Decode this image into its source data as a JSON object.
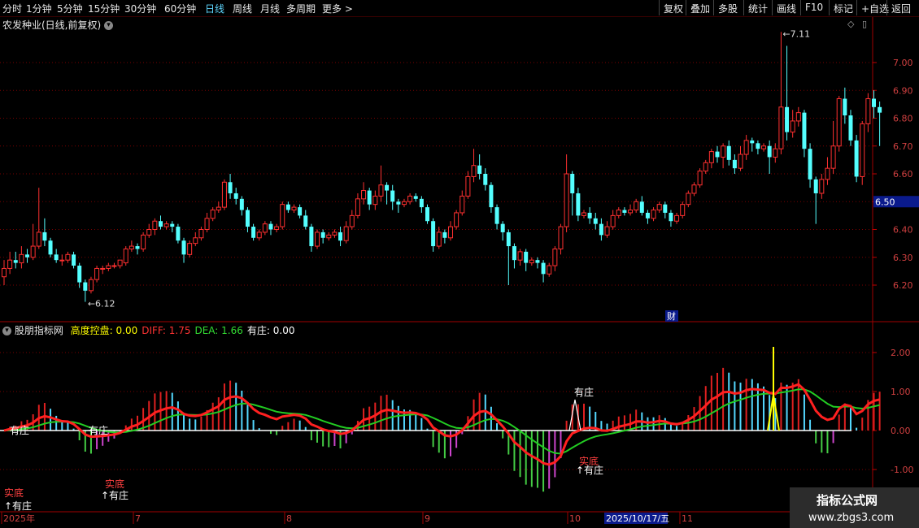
{
  "toolbar": {
    "periods": [
      "分时",
      "1分钟",
      "5分钟",
      "15分钟",
      "30分钟",
      "60分钟",
      "日线",
      "周线",
      "月线",
      "多周期",
      "更多 >"
    ],
    "active_period": "日线",
    "actions": [
      "复权",
      "叠加",
      "多股",
      "统计",
      "画线",
      "F10",
      "标记",
      "+自选",
      "返回"
    ]
  },
  "main_chart": {
    "title": "农发种业(日线,前复权)",
    "price_ticks": [
      "7.00",
      "6.90",
      "6.80",
      "6.70",
      "6.60",
      "6.50",
      "6.40",
      "6.30",
      "6.20"
    ],
    "current_price": "6.50",
    "high_label": "7.11",
    "low_label": "6.12",
    "marker": "财"
  },
  "indicator": {
    "name": "股朋指标网",
    "fields": [
      {
        "label": "高度控盘:",
        "value": "0.00",
        "color": "#ffff00"
      },
      {
        "label": "DIFF:",
        "value": "1.75",
        "color": "#ff3333"
      },
      {
        "label": "DEA:",
        "value": "1.66",
        "color": "#33dd33"
      },
      {
        "label": "有庄:",
        "value": "0.00",
        "color": "#ffffff"
      }
    ],
    "ticks": [
      "2.00",
      "1.00",
      "0.00",
      "-1.00"
    ],
    "labels": {
      "youzhuang": "有庄",
      "up_youzhuang": "↑有庄",
      "shidi": "实底"
    }
  },
  "time_axis": {
    "labels": [
      "2025年",
      "7",
      "8",
      "9",
      "10",
      "2025/10/17/五",
      "11"
    ]
  },
  "watermark": {
    "line1": "指标公式网",
    "line2": "www.zbgs3.com"
  },
  "chart_data": {
    "type": "candlestick",
    "y_range": [
      6.12,
      7.11
    ],
    "indicator_y_range": [
      -1.65,
      2.45
    ],
    "candles": [
      [
        6.23,
        6.26,
        6.2,
        6.29
      ],
      [
        6.26,
        6.29,
        6.24,
        6.32
      ],
      [
        6.29,
        6.28,
        6.26,
        6.32
      ],
      [
        6.28,
        6.31,
        6.26,
        6.34
      ],
      [
        6.31,
        6.3,
        6.28,
        6.33
      ],
      [
        6.3,
        6.34,
        6.29,
        6.42
      ],
      [
        6.34,
        6.39,
        6.33,
        6.55
      ],
      [
        6.39,
        6.36,
        6.34,
        6.44
      ],
      [
        6.36,
        6.31,
        6.3,
        6.37
      ],
      [
        6.31,
        6.29,
        6.28,
        6.33
      ],
      [
        6.29,
        6.29,
        6.27,
        6.31
      ],
      [
        6.29,
        6.31,
        6.28,
        6.32
      ],
      [
        6.31,
        6.27,
        6.26,
        6.32
      ],
      [
        6.27,
        6.21,
        6.19,
        6.28
      ],
      [
        6.21,
        6.18,
        6.14,
        6.22
      ],
      [
        6.18,
        6.22,
        6.17,
        6.23
      ],
      [
        6.22,
        6.26,
        6.21,
        6.27
      ],
      [
        6.26,
        6.26,
        6.24,
        6.27
      ],
      [
        6.26,
        6.27,
        6.25,
        6.28
      ],
      [
        6.27,
        6.27,
        6.26,
        6.28
      ],
      [
        6.27,
        6.29,
        6.26,
        6.29
      ],
      [
        6.28,
        6.33,
        6.27,
        6.34
      ],
      [
        6.33,
        6.34,
        6.32,
        6.36
      ],
      [
        6.34,
        6.33,
        6.31,
        6.35
      ],
      [
        6.33,
        6.38,
        6.32,
        6.39
      ],
      [
        6.38,
        6.4,
        6.37,
        6.42
      ],
      [
        6.4,
        6.43,
        6.38,
        6.44
      ],
      [
        6.43,
        6.41,
        6.4,
        6.45
      ],
      [
        6.41,
        6.42,
        6.4,
        6.43
      ],
      [
        6.42,
        6.41,
        6.39,
        6.43
      ],
      [
        6.41,
        6.36,
        6.35,
        6.42
      ],
      [
        6.36,
        6.31,
        6.28,
        6.37
      ],
      [
        6.31,
        6.35,
        6.3,
        6.36
      ],
      [
        6.35,
        6.37,
        6.34,
        6.39
      ],
      [
        6.37,
        6.4,
        6.36,
        6.41
      ],
      [
        6.4,
        6.44,
        6.39,
        6.46
      ],
      [
        6.44,
        6.47,
        6.43,
        6.48
      ],
      [
        6.47,
        6.48,
        6.46,
        6.5
      ],
      [
        6.48,
        6.57,
        6.47,
        6.58
      ],
      [
        6.57,
        6.53,
        6.51,
        6.6
      ],
      [
        6.53,
        6.51,
        6.49,
        6.55
      ],
      [
        6.51,
        6.47,
        6.45,
        6.52
      ],
      [
        6.47,
        6.41,
        6.39,
        6.48
      ],
      [
        6.41,
        6.37,
        6.36,
        6.42
      ],
      [
        6.37,
        6.39,
        6.36,
        6.4
      ],
      [
        6.39,
        6.42,
        6.38,
        6.43
      ],
      [
        6.42,
        6.4,
        6.38,
        6.43
      ],
      [
        6.4,
        6.41,
        6.39,
        6.42
      ],
      [
        6.41,
        6.49,
        6.4,
        6.5
      ],
      [
        6.49,
        6.47,
        6.46,
        6.5
      ],
      [
        6.47,
        6.48,
        6.46,
        6.49
      ],
      [
        6.48,
        6.45,
        6.44,
        6.49
      ],
      [
        6.45,
        6.41,
        6.4,
        6.47
      ],
      [
        6.41,
        6.34,
        6.32,
        6.42
      ],
      [
        6.34,
        6.39,
        6.33,
        6.4
      ],
      [
        6.39,
        6.37,
        6.35,
        6.4
      ],
      [
        6.37,
        6.38,
        6.36,
        6.39
      ],
      [
        6.38,
        6.39,
        6.37,
        6.4
      ],
      [
        6.39,
        6.36,
        6.34,
        6.41
      ],
      [
        6.36,
        6.41,
        6.35,
        6.43
      ],
      [
        6.41,
        6.45,
        6.4,
        6.47
      ],
      [
        6.45,
        6.51,
        6.44,
        6.53
      ],
      [
        6.51,
        6.54,
        6.49,
        6.57
      ],
      [
        6.54,
        6.49,
        6.47,
        6.55
      ],
      [
        6.49,
        6.52,
        6.47,
        6.54
      ],
      [
        6.52,
        6.56,
        6.5,
        6.63
      ],
      [
        6.56,
        6.54,
        6.49,
        6.57
      ],
      [
        6.54,
        6.5,
        6.47,
        6.56
      ],
      [
        6.5,
        6.49,
        6.46,
        6.51
      ],
      [
        6.49,
        6.5,
        6.48,
        6.51
      ],
      [
        6.5,
        6.52,
        6.49,
        6.53
      ],
      [
        6.52,
        6.51,
        6.5,
        6.53
      ],
      [
        6.51,
        6.48,
        6.46,
        6.52
      ],
      [
        6.48,
        6.43,
        6.42,
        6.49
      ],
      [
        6.43,
        6.34,
        6.32,
        6.44
      ],
      [
        6.34,
        6.39,
        6.33,
        6.41
      ],
      [
        6.39,
        6.37,
        6.35,
        6.4
      ],
      [
        6.37,
        6.41,
        6.36,
        6.43
      ],
      [
        6.41,
        6.46,
        6.4,
        6.47
      ],
      [
        6.46,
        6.52,
        6.45,
        6.54
      ],
      [
        6.52,
        6.59,
        6.51,
        6.61
      ],
      [
        6.59,
        6.63,
        6.57,
        6.69
      ],
      [
        6.63,
        6.6,
        6.58,
        6.67
      ],
      [
        6.6,
        6.56,
        6.54,
        6.62
      ],
      [
        6.56,
        6.48,
        6.46,
        6.57
      ],
      [
        6.48,
        6.42,
        6.4,
        6.49
      ],
      [
        6.42,
        6.39,
        6.36,
        6.43
      ],
      [
        6.39,
        6.34,
        6.2,
        6.4
      ],
      [
        6.34,
        6.29,
        6.26,
        6.35
      ],
      [
        6.29,
        6.32,
        6.27,
        6.33
      ],
      [
        6.32,
        6.28,
        6.25,
        6.33
      ],
      [
        6.28,
        6.29,
        6.27,
        6.3
      ],
      [
        6.29,
        6.28,
        6.26,
        6.3
      ],
      [
        6.28,
        6.24,
        6.21,
        6.29
      ],
      [
        6.24,
        6.27,
        6.23,
        6.28
      ],
      [
        6.27,
        6.33,
        6.25,
        6.34
      ],
      [
        6.33,
        6.41,
        6.31,
        6.42
      ],
      [
        6.41,
        6.6,
        6.39,
        6.67
      ],
      [
        6.6,
        6.53,
        6.45,
        6.61
      ],
      [
        6.53,
        6.45,
        6.43,
        6.55
      ],
      [
        6.45,
        6.46,
        6.44,
        6.47
      ],
      [
        6.46,
        6.44,
        6.42,
        6.48
      ],
      [
        6.44,
        6.42,
        6.4,
        6.46
      ],
      [
        6.42,
        6.38,
        6.36,
        6.44
      ],
      [
        6.38,
        6.41,
        6.37,
        6.43
      ],
      [
        6.41,
        6.45,
        6.4,
        6.47
      ],
      [
        6.45,
        6.47,
        6.44,
        6.48
      ],
      [
        6.47,
        6.46,
        6.45,
        6.48
      ],
      [
        6.46,
        6.47,
        6.45,
        6.49
      ],
      [
        6.47,
        6.5,
        6.46,
        6.51
      ],
      [
        6.5,
        6.46,
        6.45,
        6.52
      ],
      [
        6.46,
        6.44,
        6.42,
        6.47
      ],
      [
        6.44,
        6.47,
        6.43,
        6.48
      ],
      [
        6.47,
        6.49,
        6.46,
        6.5
      ],
      [
        6.49,
        6.46,
        6.44,
        6.5
      ],
      [
        6.46,
        6.43,
        6.41,
        6.47
      ],
      [
        6.43,
        6.45,
        6.42,
        6.46
      ],
      [
        6.45,
        6.49,
        6.44,
        6.5
      ],
      [
        6.49,
        6.53,
        6.48,
        6.54
      ],
      [
        6.53,
        6.56,
        6.52,
        6.57
      ],
      [
        6.56,
        6.61,
        6.55,
        6.62
      ],
      [
        6.61,
        6.64,
        6.6,
        6.65
      ],
      [
        6.64,
        6.68,
        6.62,
        6.69
      ],
      [
        6.68,
        6.66,
        6.64,
        6.7
      ],
      [
        6.66,
        6.7,
        6.62,
        6.71
      ],
      [
        6.7,
        6.65,
        6.63,
        6.72
      ],
      [
        6.65,
        6.62,
        6.6,
        6.67
      ],
      [
        6.62,
        6.67,
        6.61,
        6.7
      ],
      [
        6.67,
        6.72,
        6.65,
        6.74
      ],
      [
        6.72,
        6.71,
        6.68,
        6.73
      ],
      [
        6.71,
        6.69,
        6.67,
        6.72
      ],
      [
        6.69,
        6.7,
        6.68,
        6.71
      ],
      [
        6.7,
        6.66,
        6.6,
        6.72
      ],
      [
        6.66,
        6.69,
        6.64,
        6.71
      ],
      [
        6.69,
        6.84,
        6.67,
        7.11
      ],
      [
        6.84,
        6.75,
        6.72,
        7.06
      ],
      [
        6.75,
        6.79,
        6.73,
        6.83
      ],
      [
        6.79,
        6.82,
        6.77,
        6.84
      ],
      [
        6.82,
        6.69,
        6.66,
        6.83
      ],
      [
        6.69,
        6.58,
        6.55,
        6.71
      ],
      [
        6.58,
        6.53,
        6.42,
        6.59
      ],
      [
        6.53,
        6.58,
        6.51,
        6.6
      ],
      [
        6.58,
        6.62,
        6.56,
        6.66
      ],
      [
        6.62,
        6.7,
        6.6,
        6.79
      ],
      [
        6.7,
        6.87,
        6.68,
        6.88
      ],
      [
        6.87,
        6.81,
        6.78,
        6.91
      ],
      [
        6.81,
        6.72,
        6.7,
        6.83
      ],
      [
        6.72,
        6.59,
        6.57,
        6.74
      ],
      [
        6.59,
        6.78,
        6.56,
        6.79
      ],
      [
        6.78,
        6.87,
        6.75,
        6.89
      ],
      [
        6.87,
        6.84,
        6.8,
        6.9
      ],
      [
        6.84,
        6.82,
        6.7,
        6.86
      ]
    ]
  }
}
